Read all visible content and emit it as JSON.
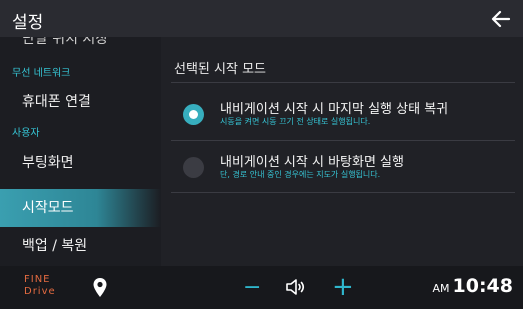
{
  "header": {
    "title": "설정"
  },
  "sidebar": {
    "cut_item": "단말 위치 저장",
    "sections": [
      {
        "label": "무선 네트워크",
        "items": [
          {
            "label": "휴대폰 연결"
          }
        ]
      },
      {
        "label": "사용자",
        "items": [
          {
            "label": "부팅화면"
          },
          {
            "label": "시작모드"
          },
          {
            "label": "백업 / 복원"
          }
        ]
      }
    ],
    "active": "시작모드"
  },
  "main": {
    "section_title": "선택된 시작 모드",
    "options": [
      {
        "title": "내비게이션 시작 시 마지막 실행 상태 복귀",
        "desc": "시동을 켜면 시동 끄기 전 상태로 실행됩니다.",
        "selected": true
      },
      {
        "title": "내비게이션 시작 시 바탕화면 실행",
        "desc": "단, 경로 안내 중인 경우에는 지도가 실행됩니다.",
        "selected": false
      }
    ]
  },
  "bottom": {
    "logo_line1": "FINE",
    "logo_line2": "Drive",
    "volume_minus": "−",
    "volume_plus": "+",
    "clock_ampm": "AM",
    "clock_time": "10:48"
  },
  "colors": {
    "accent": "#36c5d5",
    "active_item": "#3a9fb0",
    "logo": "#e36a40"
  },
  "icons": {
    "back": "arrow-left-icon",
    "location": "map-pin-icon",
    "volume": "speaker-icon"
  }
}
